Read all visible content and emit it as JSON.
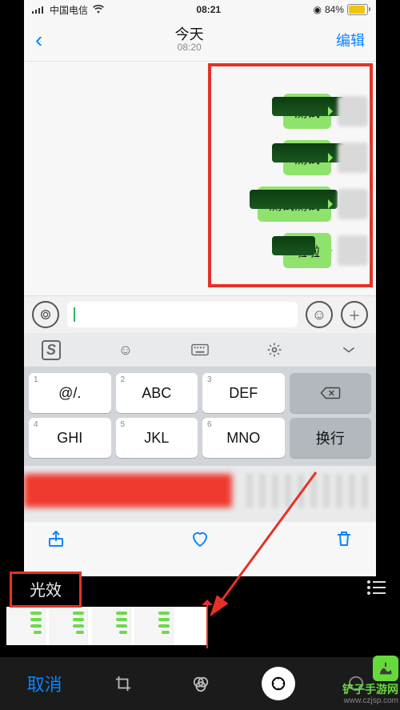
{
  "status": {
    "carrier": "中国电信",
    "time": "08:21",
    "battery": "84%"
  },
  "nav": {
    "title": "今天",
    "subtitle": "08:20",
    "edit": "编辑"
  },
  "messages": [
    {
      "text": "测试"
    },
    {
      "text": "测试"
    },
    {
      "text": "测试测试"
    },
    {
      "text": "啦啦"
    }
  ],
  "keyboard": {
    "row1": [
      {
        "n": "1",
        "l": "@/."
      },
      {
        "n": "2",
        "l": "ABC"
      },
      {
        "n": "3",
        "l": "DEF"
      }
    ],
    "row2": [
      {
        "n": "4",
        "l": "GHI"
      },
      {
        "n": "5",
        "l": "JKL"
      },
      {
        "n": "6",
        "l": "MNO"
      }
    ],
    "return": "换行"
  },
  "editor": {
    "lightfx": "光效",
    "cancel": "取消"
  },
  "watermark": {
    "name": "铲子手游网",
    "url": "www.czjsp.com"
  }
}
